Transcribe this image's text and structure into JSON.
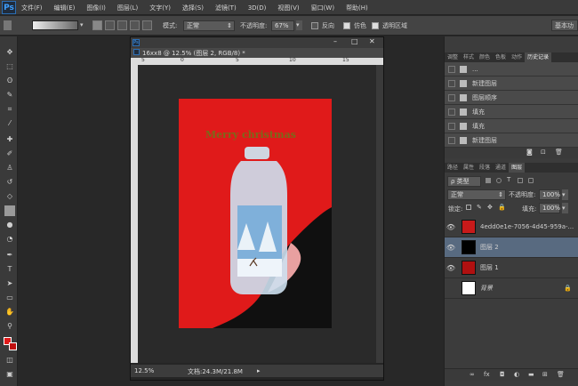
{
  "app": {
    "logo": "Ps",
    "menus": [
      "文件(F)",
      "编辑(E)",
      "图像(I)",
      "图层(L)",
      "文字(Y)",
      "选择(S)",
      "滤镜(T)",
      "3D(D)",
      "视图(V)",
      "窗口(W)",
      "帮助(H)"
    ]
  },
  "options": {
    "mode_label": "模式:",
    "mode_value": "正常",
    "opacity_label": "不透明度:",
    "opacity_value": "67%",
    "reverse_label": "反向",
    "dither_label": "仿色",
    "transparency_label": "透明区域",
    "workspace": "基本功"
  },
  "document": {
    "tab_title": "16xx8 @ 12.5% (图层 2, RGB/8) *",
    "ruler_h": [
      "5",
      "0",
      "5",
      "10",
      "15"
    ],
    "zoom": "12.5%",
    "doc_info": "文档:24.3M/21.8M",
    "canvas_text": "Merry christmas",
    "colors": {
      "red": "#e01a1a",
      "curl": "#e8a0a0",
      "bg": "#101010"
    }
  },
  "history": {
    "tabs": [
      "调整",
      "样式",
      "颜色",
      "色板",
      "动作",
      "历史记录"
    ],
    "items": [
      "...",
      "新建图层",
      "图层顺序",
      "填充",
      "填充",
      "新建图层",
      "填充"
    ]
  },
  "layers": {
    "tabs": [
      "路径",
      "属性",
      "段落",
      "通道",
      "图层"
    ],
    "filter": "ρ 类型",
    "blend": "正常",
    "opacity_label": "不透明度:",
    "opacity": "100%",
    "lock_label": "锁定:",
    "fill_label": "填充:",
    "fill": "100%",
    "items": [
      {
        "name": "4edd0e1e-7056-4d45-959a-...",
        "eye": "👁"
      },
      {
        "name": "图层 2",
        "eye": "👁"
      },
      {
        "name": "图层 1",
        "eye": "👁"
      },
      {
        "name": "背景",
        "eye": ""
      }
    ]
  }
}
